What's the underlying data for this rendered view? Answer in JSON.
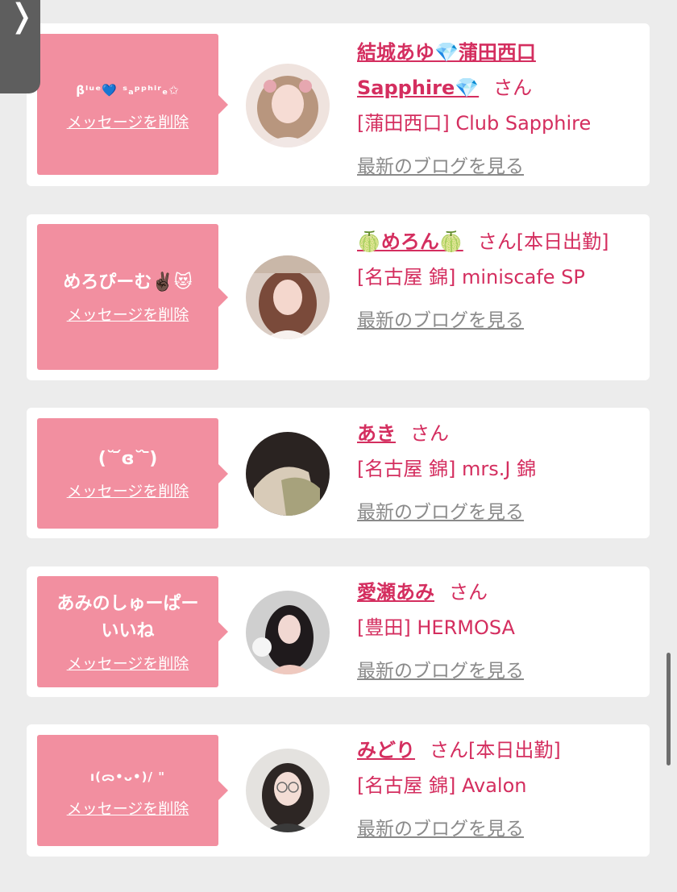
{
  "nav": {
    "back_icon": "❭"
  },
  "common": {
    "delete_label": "メッセージを削除",
    "blog_label": "最新のブログを見る",
    "san": "さん"
  },
  "items": [
    {
      "message": "βˡᵘᵉ💙 ˢₐᵖᵖʰⁱʳₑ✩",
      "name": "結城あゆ💎蒲田西口 Sapphire💎",
      "extra": "",
      "shop": "[蒲田西口] Club Sapphire"
    },
    {
      "message": "めろぴーむ✌🏿😻",
      "name": "🍈めろん🍈",
      "extra": "[本日出勤]",
      "shop": "[名古屋 錦] miniscafe SP"
    },
    {
      "message": "(˘ ᷄ɞ˘ ᷅)",
      "name": "あき",
      "extra": "",
      "shop": "[名古屋 錦] mrs.J 錦"
    },
    {
      "message": "あみのしゅーぱー\nいいね",
      "name": "愛瀬あみ",
      "extra": "",
      "shop": "[豊田] HERMOSA"
    },
    {
      "message": "ı(ᯅ•ᴗ•)/ \"",
      "name": "みどり",
      "extra": "[本日出勤]",
      "shop": "[名古屋 錦] Avalon"
    }
  ],
  "colors": {
    "accent": "#d42e5f",
    "bubble": "#f28fa0",
    "muted": "#8a8a8a"
  }
}
